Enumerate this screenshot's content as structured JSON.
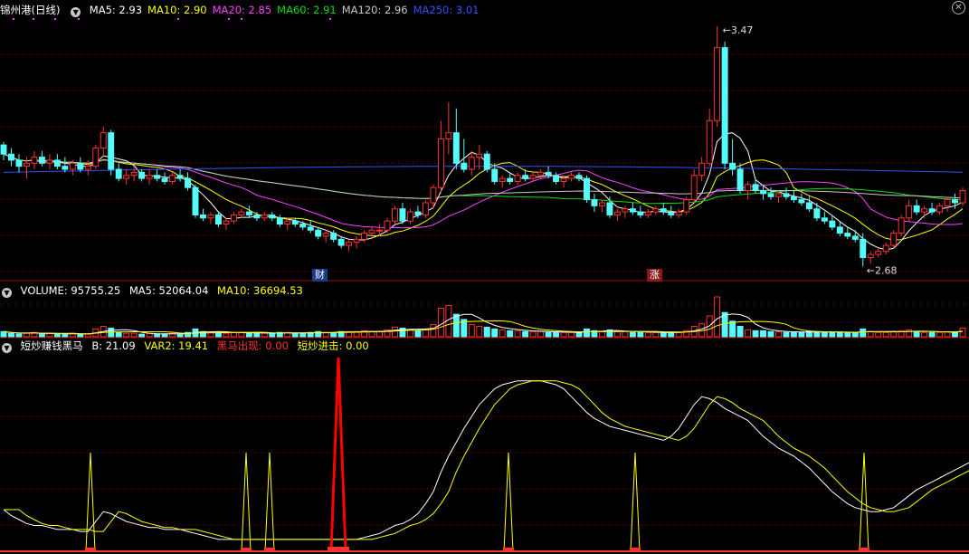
{
  "main_panel": {
    "title": "锦州港(日线)",
    "ma": [
      {
        "label": "MA5:",
        "value": "2.93",
        "color": "#ffffff"
      },
      {
        "label": "MA10:",
        "value": "2.90",
        "color": "#ffff00"
      },
      {
        "label": "MA20:",
        "value": "2.85",
        "color": "#ff40ff"
      },
      {
        "label": "MA60:",
        "value": "2.91",
        "color": "#00e000"
      },
      {
        "label": "MA120:",
        "value": "2.96",
        "color": "#c8c8c8"
      },
      {
        "label": "MA250:",
        "value": "3.01",
        "color": "#3050ff"
      }
    ],
    "high_label": "3.47",
    "low_label": "2.68",
    "event_tags": [
      "财",
      "涨"
    ],
    "close_icon": "close-icon"
  },
  "volume_panel": {
    "label": "VOLUME:",
    "value": "95755.25",
    "ma5_label": "MA5:",
    "ma5_value": "52064.04",
    "ma10_label": "MA10:",
    "ma10_value": "36694.53"
  },
  "indicator_panel": {
    "name": "短炒赚钱黑马",
    "b_label": "B:",
    "b_value": "21.09",
    "var2_label": "VAR2:",
    "var2_value": "19.41",
    "hm_label": "黑马出现:",
    "hm_value": "0.00",
    "dc_label": "短炒进击:",
    "dc_value": "0.00"
  },
  "colors": {
    "up": "#ff3232",
    "down": "#54fcfc",
    "grid": "#8b0000",
    "border": "#aa0000"
  },
  "chart_data": {
    "type": "candlestick",
    "candles": [
      [
        3.08,
        3.09,
        3.03,
        3.05
      ],
      [
        3.05,
        3.07,
        3.01,
        3.03
      ],
      [
        3.03,
        3.05,
        2.99,
        3.01
      ],
      [
        3.01,
        3.04,
        2.97,
        3.02
      ],
      [
        3.02,
        3.06,
        3.0,
        3.04
      ],
      [
        3.04,
        3.06,
        3.01,
        3.02
      ],
      [
        3.02,
        3.05,
        3.0,
        3.03
      ],
      [
        3.03,
        3.05,
        3.0,
        3.01
      ],
      [
        3.01,
        3.04,
        2.99,
        3.0
      ],
      [
        3.0,
        3.03,
        2.98,
        3.02
      ],
      [
        3.02,
        3.04,
        2.99,
        3.0
      ],
      [
        3.0,
        3.03,
        2.98,
        3.01
      ],
      [
        3.01,
        3.08,
        3.0,
        3.07
      ],
      [
        3.07,
        3.14,
        3.04,
        3.12
      ],
      [
        3.12,
        3.13,
        2.98,
        3.0
      ],
      [
        3.0,
        3.02,
        2.96,
        2.97
      ],
      [
        2.97,
        3.0,
        2.95,
        2.98
      ],
      [
        2.98,
        3.01,
        2.96,
        2.99
      ],
      [
        2.99,
        3.0,
        2.96,
        2.97
      ],
      [
        2.97,
        3.0,
        2.95,
        2.98
      ],
      [
        2.98,
        3.0,
        2.96,
        2.97
      ],
      [
        2.97,
        2.99,
        2.95,
        2.96
      ],
      [
        2.96,
        2.99,
        2.95,
        2.98
      ],
      [
        2.98,
        3.0,
        2.96,
        2.97
      ],
      [
        2.97,
        2.99,
        2.93,
        2.94
      ],
      [
        2.94,
        2.95,
        2.84,
        2.85
      ],
      [
        2.85,
        2.87,
        2.83,
        2.84
      ],
      [
        2.84,
        2.86,
        2.82,
        2.85
      ],
      [
        2.85,
        2.86,
        2.81,
        2.82
      ],
      [
        2.82,
        2.84,
        2.8,
        2.83
      ],
      [
        2.83,
        2.86,
        2.82,
        2.85
      ],
      [
        2.85,
        2.87,
        2.84,
        2.86
      ],
      [
        2.86,
        2.88,
        2.84,
        2.85
      ],
      [
        2.85,
        2.86,
        2.83,
        2.84
      ],
      [
        2.84,
        2.86,
        2.83,
        2.85
      ],
      [
        2.85,
        2.86,
        2.83,
        2.84
      ],
      [
        2.84,
        2.85,
        2.81,
        2.82
      ],
      [
        2.82,
        2.84,
        2.8,
        2.83
      ],
      [
        2.83,
        2.84,
        2.81,
        2.82
      ],
      [
        2.82,
        2.83,
        2.8,
        2.81
      ],
      [
        2.81,
        2.83,
        2.79,
        2.8
      ],
      [
        2.8,
        2.81,
        2.77,
        2.78
      ],
      [
        2.78,
        2.8,
        2.76,
        2.79
      ],
      [
        2.79,
        2.8,
        2.76,
        2.77
      ],
      [
        2.77,
        2.78,
        2.74,
        2.75
      ],
      [
        2.75,
        2.77,
        2.73,
        2.76
      ],
      [
        2.76,
        2.78,
        2.74,
        2.77
      ],
      [
        2.77,
        2.8,
        2.76,
        2.79
      ],
      [
        2.79,
        2.81,
        2.77,
        2.8
      ],
      [
        2.8,
        2.82,
        2.78,
        2.8
      ],
      [
        2.8,
        2.84,
        2.79,
        2.83
      ],
      [
        2.83,
        2.88,
        2.82,
        2.87
      ],
      [
        2.87,
        2.89,
        2.82,
        2.83
      ],
      [
        2.83,
        2.87,
        2.82,
        2.86
      ],
      [
        2.86,
        2.88,
        2.84,
        2.85
      ],
      [
        2.85,
        2.9,
        2.84,
        2.89
      ],
      [
        2.89,
        2.95,
        2.87,
        2.94
      ],
      [
        2.94,
        3.16,
        2.92,
        3.1
      ],
      [
        3.1,
        3.22,
        3.05,
        3.12
      ],
      [
        3.12,
        3.2,
        3.0,
        3.02
      ],
      [
        3.02,
        3.1,
        2.99,
        3.0
      ],
      [
        3.0,
        3.06,
        2.98,
        3.04
      ],
      [
        3.04,
        3.08,
        3.0,
        3.05
      ],
      [
        3.05,
        3.06,
        2.99,
        3.0
      ],
      [
        3.0,
        3.02,
        2.95,
        2.96
      ],
      [
        2.96,
        2.98,
        2.94,
        2.97
      ],
      [
        2.97,
        2.99,
        2.95,
        2.96
      ],
      [
        2.96,
        2.99,
        2.95,
        2.98
      ],
      [
        2.98,
        3.0,
        2.96,
        2.97
      ],
      [
        2.97,
        2.99,
        2.96,
        2.98
      ],
      [
        2.98,
        3.0,
        2.97,
        2.99
      ],
      [
        2.99,
        3.01,
        2.97,
        2.98
      ],
      [
        2.98,
        2.99,
        2.95,
        2.96
      ],
      [
        2.96,
        2.98,
        2.94,
        2.97
      ],
      [
        2.97,
        2.99,
        2.96,
        2.98
      ],
      [
        2.98,
        2.99,
        2.96,
        2.97
      ],
      [
        2.97,
        2.98,
        2.89,
        2.9
      ],
      [
        2.9,
        2.92,
        2.86,
        2.88
      ],
      [
        2.88,
        2.9,
        2.86,
        2.89
      ],
      [
        2.89,
        2.91,
        2.84,
        2.85
      ],
      [
        2.85,
        2.87,
        2.83,
        2.86
      ],
      [
        2.86,
        2.88,
        2.84,
        2.87
      ],
      [
        2.87,
        2.89,
        2.85,
        2.86
      ],
      [
        2.86,
        2.88,
        2.84,
        2.85
      ],
      [
        2.85,
        2.87,
        2.84,
        2.86
      ],
      [
        2.86,
        2.88,
        2.85,
        2.87
      ],
      [
        2.87,
        2.89,
        2.85,
        2.86
      ],
      [
        2.86,
        2.88,
        2.84,
        2.85
      ],
      [
        2.85,
        2.87,
        2.84,
        2.86
      ],
      [
        2.86,
        2.91,
        2.85,
        2.9
      ],
      [
        2.9,
        3.0,
        2.89,
        2.98
      ],
      [
        2.98,
        3.04,
        2.96,
        3.02
      ],
      [
        3.02,
        3.2,
        3.01,
        3.16
      ],
      [
        3.16,
        3.47,
        3.14,
        3.4
      ],
      [
        3.4,
        3.42,
        3.0,
        3.02
      ],
      [
        3.02,
        3.1,
        2.98,
        3.0
      ],
      [
        3.0,
        3.02,
        2.92,
        2.93
      ],
      [
        2.93,
        2.96,
        2.9,
        2.95
      ],
      [
        2.95,
        2.97,
        2.92,
        2.93
      ],
      [
        2.93,
        2.95,
        2.9,
        2.92
      ],
      [
        2.92,
        2.94,
        2.9,
        2.91
      ],
      [
        2.91,
        2.93,
        2.89,
        2.92
      ],
      [
        2.92,
        2.94,
        2.9,
        2.91
      ],
      [
        2.91,
        2.93,
        2.89,
        2.9
      ],
      [
        2.9,
        2.92,
        2.88,
        2.89
      ],
      [
        2.89,
        2.91,
        2.86,
        2.87
      ],
      [
        2.87,
        2.89,
        2.83,
        2.84
      ],
      [
        2.84,
        2.86,
        2.82,
        2.83
      ],
      [
        2.83,
        2.85,
        2.8,
        2.81
      ],
      [
        2.81,
        2.83,
        2.78,
        2.79
      ],
      [
        2.79,
        2.81,
        2.77,
        2.78
      ],
      [
        2.78,
        2.8,
        2.76,
        2.77
      ],
      [
        2.77,
        2.79,
        2.68,
        2.71
      ],
      [
        2.71,
        2.73,
        2.69,
        2.72
      ],
      [
        2.72,
        2.74,
        2.71,
        2.73
      ],
      [
        2.73,
        2.76,
        2.72,
        2.75
      ],
      [
        2.75,
        2.8,
        2.74,
        2.79
      ],
      [
        2.79,
        2.85,
        2.78,
        2.84
      ],
      [
        2.84,
        2.9,
        2.83,
        2.88
      ],
      [
        2.88,
        2.9,
        2.85,
        2.86
      ],
      [
        2.86,
        2.88,
        2.84,
        2.87
      ],
      [
        2.87,
        2.89,
        2.85,
        2.86
      ],
      [
        2.86,
        2.89,
        2.85,
        2.88
      ],
      [
        2.88,
        2.91,
        2.86,
        2.9
      ],
      [
        2.9,
        2.92,
        2.87,
        2.89
      ],
      [
        2.89,
        2.94,
        2.88,
        2.93
      ]
    ],
    "price_range": [
      2.64,
      3.5
    ],
    "volume": [
      6,
      4,
      3,
      4,
      5,
      3,
      4,
      3,
      3,
      4,
      3,
      3,
      9,
      12,
      10,
      5,
      4,
      4,
      3,
      4,
      3,
      3,
      4,
      3,
      5,
      9,
      6,
      5,
      5,
      4,
      5,
      5,
      4,
      4,
      4,
      4,
      5,
      5,
      4,
      4,
      5,
      6,
      5,
      5,
      6,
      6,
      6,
      7,
      6,
      6,
      8,
      11,
      10,
      8,
      7,
      9,
      14,
      33,
      36,
      26,
      20,
      14,
      12,
      11,
      9,
      8,
      7,
      7,
      6,
      6,
      6,
      5,
      5,
      5,
      5,
      5,
      9,
      7,
      6,
      8,
      6,
      6,
      5,
      5,
      5,
      5,
      5,
      5,
      5,
      7,
      12,
      15,
      24,
      46,
      28,
      18,
      12,
      8,
      7,
      7,
      6,
      6,
      5,
      5,
      5,
      6,
      6,
      5,
      5,
      5,
      5,
      5,
      9,
      6,
      5,
      5,
      6,
      7,
      8,
      6,
      5,
      5,
      5,
      6,
      5,
      10
    ],
    "var2": [
      21,
      18,
      16,
      14,
      13,
      13,
      12,
      11,
      11,
      11,
      10,
      10,
      15,
      20,
      19,
      17,
      15,
      14,
      13,
      12,
      12,
      11,
      11,
      11,
      10,
      9,
      8,
      7,
      6,
      6,
      6,
      6,
      6,
      6,
      6,
      6,
      6,
      6,
      6,
      6,
      6,
      6,
      6,
      6,
      6,
      6,
      6,
      7,
      8,
      9,
      11,
      13,
      14,
      16,
      19,
      24,
      30,
      40,
      48,
      55,
      62,
      68,
      74,
      78,
      82,
      84,
      85,
      86,
      86,
      86,
      86,
      85,
      84,
      82,
      78,
      74,
      70,
      67,
      65,
      63,
      62,
      61,
      60,
      59,
      58,
      57,
      56,
      58,
      62,
      68,
      74,
      78,
      77,
      75,
      72,
      70,
      68,
      66,
      62,
      58,
      55,
      52,
      50,
      48,
      45,
      42,
      38,
      34,
      30,
      27,
      24,
      22,
      21,
      20,
      20,
      21,
      22,
      25,
      28,
      31,
      33,
      35,
      37,
      39,
      41,
      43,
      45,
      47
    ],
    "b": [
      0,
      0,
      0,
      0,
      0,
      0,
      0,
      0,
      0,
      0,
      0,
      0,
      0,
      0,
      0,
      0,
      0,
      0,
      0,
      0,
      0,
      0,
      0,
      0,
      0,
      0,
      0,
      0,
      0,
      0,
      0,
      0,
      0,
      0,
      0,
      0,
      0,
      0,
      0,
      0,
      0,
      0,
      0,
      0,
      0,
      0,
      0,
      0,
      0,
      0,
      0,
      0,
      0,
      0,
      0,
      0,
      0,
      0,
      0,
      0,
      0,
      0,
      0,
      0,
      0,
      0,
      0,
      0,
      0,
      0,
      0,
      0,
      0,
      0,
      0,
      0,
      0,
      0,
      0,
      0,
      0,
      0,
      0,
      0,
      0,
      0,
      0,
      0,
      0,
      0,
      0,
      0,
      0,
      0,
      0,
      0,
      0,
      0,
      0,
      0,
      0,
      0,
      0,
      0,
      0,
      0,
      0,
      0,
      0,
      0,
      0,
      0,
      0,
      0,
      0,
      0,
      0,
      0,
      0,
      0,
      0,
      0,
      0,
      0,
      0,
      0
    ]
  }
}
